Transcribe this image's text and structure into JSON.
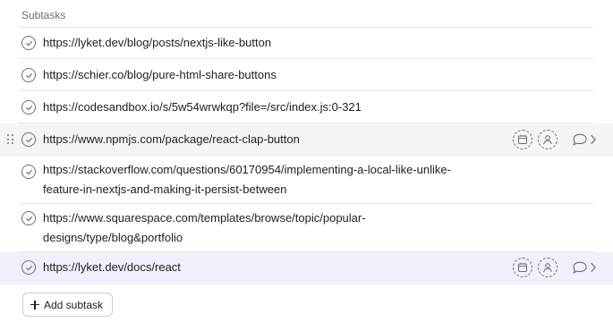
{
  "section": {
    "title": "Subtasks"
  },
  "subtasks": [
    {
      "text": "https://lyket.dev/blog/posts/nextjs-like-button",
      "state": "normal"
    },
    {
      "text": "https://schier.co/blog/pure-html-share-buttons",
      "state": "normal"
    },
    {
      "text": "https://codesandbox.io/s/5w54wrwkqp?file=/src/index.js:0-321",
      "state": "normal"
    },
    {
      "text": "https://www.npmjs.com/package/react-clap-button",
      "state": "hover"
    },
    {
      "text": "https://stackoverflow.com/questions/60170954/implementing-a-local-like-unlike-\nfeature-in-nextjs-and-making-it-persist-between",
      "state": "normal"
    },
    {
      "text": "https://www.squarespace.com/templates/browse/topic/popular-\ndesigns/type/blog&portfolio",
      "state": "normal"
    },
    {
      "text": "https://lyket.dev/docs/react",
      "state": "selected"
    }
  ],
  "add_subtask": {
    "label": "Add subtask"
  },
  "icons": {
    "check": "check-circle-icon",
    "due_date": "calendar-icon",
    "assignee": "person-icon",
    "comment": "comment-icon",
    "open": "chevron-right-icon",
    "drag": "drag-handle-icon",
    "add": "plus-icon"
  },
  "colors": {
    "hover_row": "#f5f5f5",
    "selected_row": "#eff0fb",
    "divider": "#e8e8e9",
    "text": "#1e1f21",
    "muted": "#6d6e6f"
  }
}
